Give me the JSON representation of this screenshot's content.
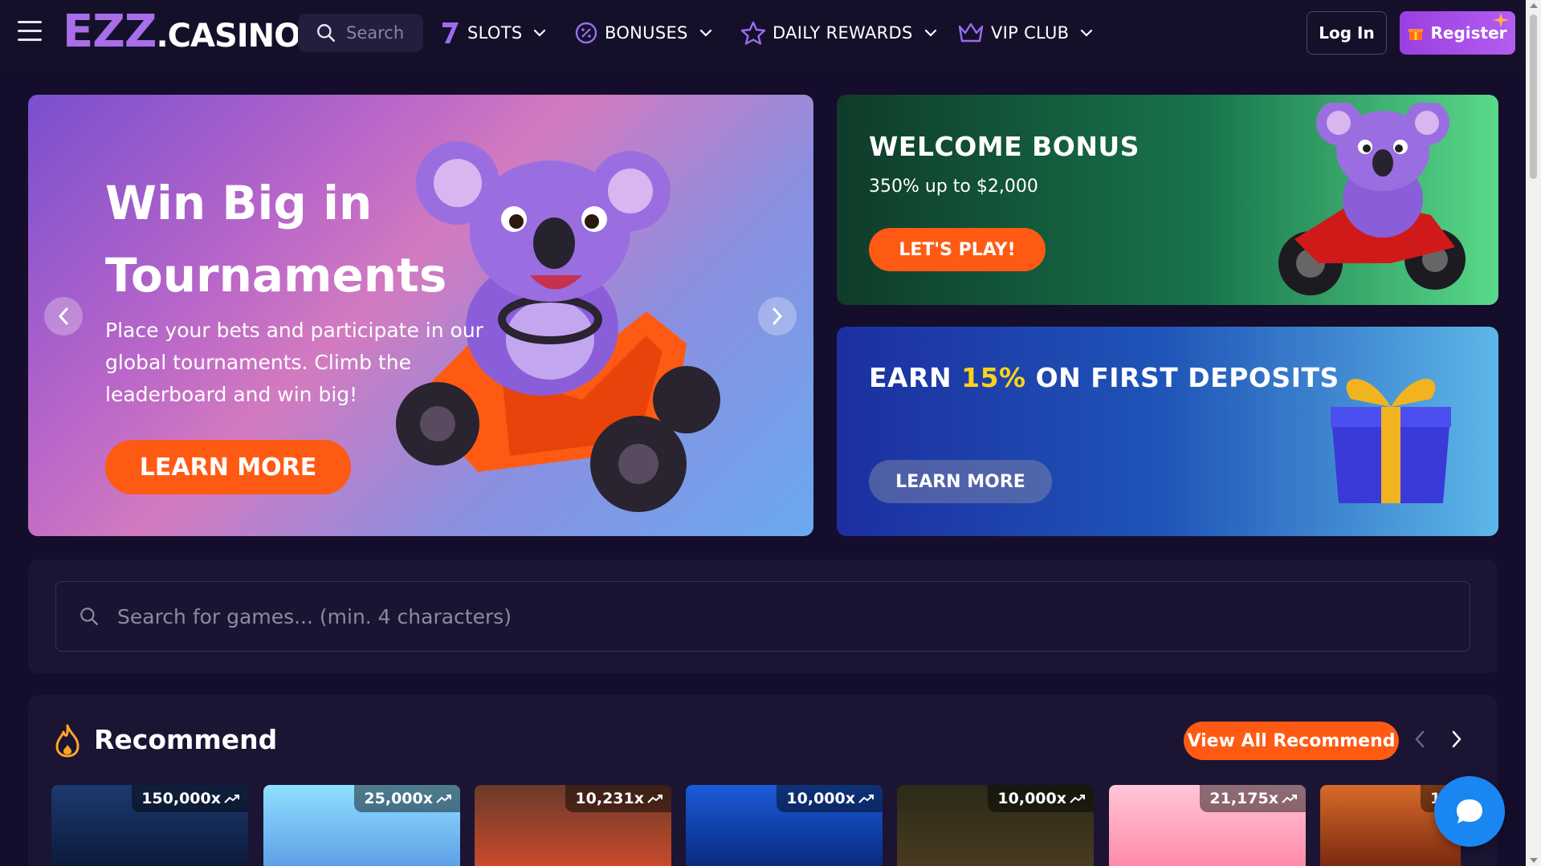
{
  "header": {
    "logo_main": "EZZ",
    "logo_suffix": ".CASINO",
    "search_placeholder": "Search",
    "nav": [
      {
        "label": "SLOTS",
        "icon": "seven-icon"
      },
      {
        "label": "BONUSES",
        "icon": "percent-badge-icon"
      },
      {
        "label": "DAILY REWARDS",
        "icon": "star-icon"
      },
      {
        "label": "VIP CLUB",
        "icon": "crown-icon"
      }
    ],
    "login_label": "Log In",
    "register_label": "Register"
  },
  "hero": {
    "title": "Win Big in Tournaments",
    "description": "Place your bets and participate in our global tournaments. Climb the leaderboard and win big!",
    "button_label": "LEARN MORE"
  },
  "promos": {
    "welcome": {
      "title": "WELCOME BONUS",
      "subtitle": "350% up to $2,000",
      "button_label": "LET'S PLAY!"
    },
    "deposit": {
      "title_pre": "EARN ",
      "title_highlight": "15%",
      "title_post": " ON FIRST DEPOSITS",
      "button_label": "LEARN MORE"
    }
  },
  "game_search": {
    "placeholder": "Search for games... (min. 4 characters)"
  },
  "recommend": {
    "title": "Recommend",
    "view_all_label": "View All Recommend",
    "tiles": [
      {
        "multiplier": "150,000x"
      },
      {
        "multiplier": "25,000x"
      },
      {
        "multiplier": "10,231x"
      },
      {
        "multiplier": "10,000x"
      },
      {
        "multiplier": "10,000x"
      },
      {
        "multiplier": "21,175x"
      },
      {
        "multiplier": "1"
      }
    ]
  },
  "colors": {
    "brand_purple": "#a86ee8",
    "accent_orange": "#ff5a14",
    "background": "#140d2b",
    "highlight_yellow": "#ffd21a",
    "chat_blue": "#1a86f2"
  }
}
